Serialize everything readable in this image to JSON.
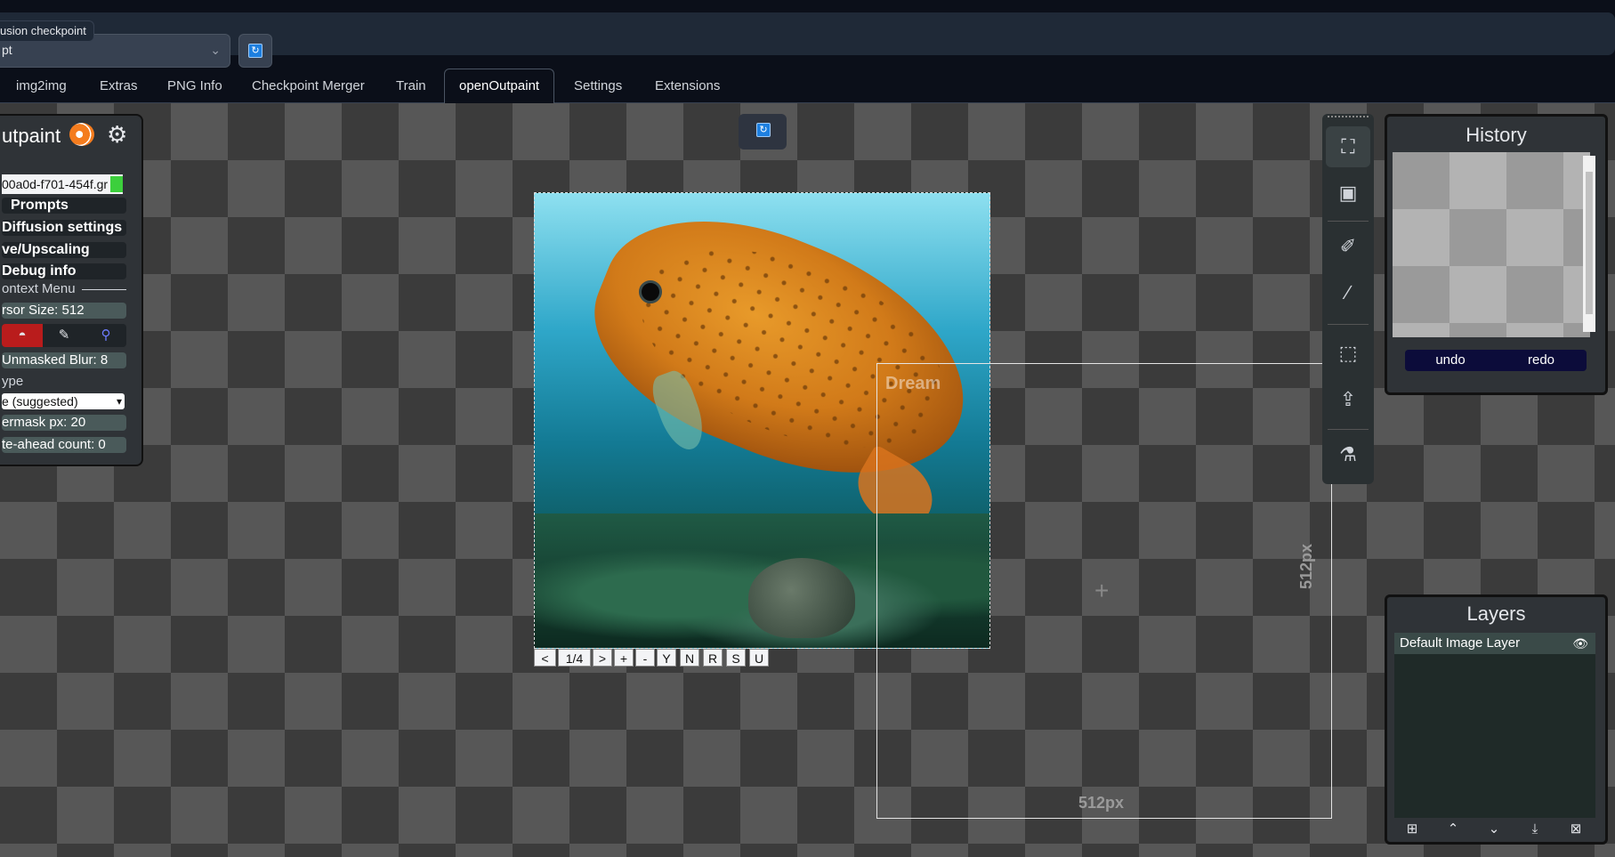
{
  "header": {
    "checkpoint_label": "usion checkpoint",
    "checkpoint_value": "pt",
    "checkpoint_chevron": "chevron-down-icon",
    "refresh_icon": "refresh-icon"
  },
  "tabs": [
    {
      "label": "img2img"
    },
    {
      "label": "Extras"
    },
    {
      "label": "PNG Info"
    },
    {
      "label": "Checkpoint Merger"
    },
    {
      "label": "Train"
    },
    {
      "label": "openOutpaint",
      "active": true
    },
    {
      "label": "Settings"
    },
    {
      "label": "Extensions"
    }
  ],
  "left_panel": {
    "title": "utpaint",
    "image_id": "00a0d-f701-454f.gr",
    "prompts_label": "Prompts",
    "diffusion_label": "Diffusion settings",
    "upscaling_label": "ve/Upscaling",
    "debug_label": "Debug info",
    "context_menu_label": "ontext Menu",
    "cursor_size": "rsor Size: 512",
    "unmasked_blur": "Unmasked Blur: 8",
    "type_label": "ype",
    "type_value": "e (suggested)",
    "overmask": "ermask px: 20",
    "lookahead": "te-ahead count: 0"
  },
  "image_nav": {
    "prev": "<",
    "count": "1/4",
    "next": ">",
    "plus": "+",
    "minus": "-",
    "y": "Y",
    "n": "N",
    "r": "R",
    "s": "S",
    "u": "U"
  },
  "dream": {
    "label": "Dream",
    "width_label": "512px",
    "height_label": "512px"
  },
  "history": {
    "title": "History",
    "undo": "undo",
    "redo": "redo"
  },
  "layers": {
    "title": "Layers",
    "items": [
      {
        "label": "Default Image Layer"
      }
    ]
  },
  "toolbar": {
    "items": [
      "dream-tool-icon",
      "img2img-tool-icon",
      "mask-brush-icon",
      "stamp-brush-icon",
      "selection-icon",
      "stamp-icon",
      "interrogate-icon"
    ]
  },
  "colors": {
    "background": "#0b0f19",
    "panel": "#2f3337",
    "accent_refresh": "#1d7fe0",
    "mask_red": "#b91c1c",
    "status_green": "#3ccf3c",
    "history_buttons": "#0c0c3a"
  }
}
